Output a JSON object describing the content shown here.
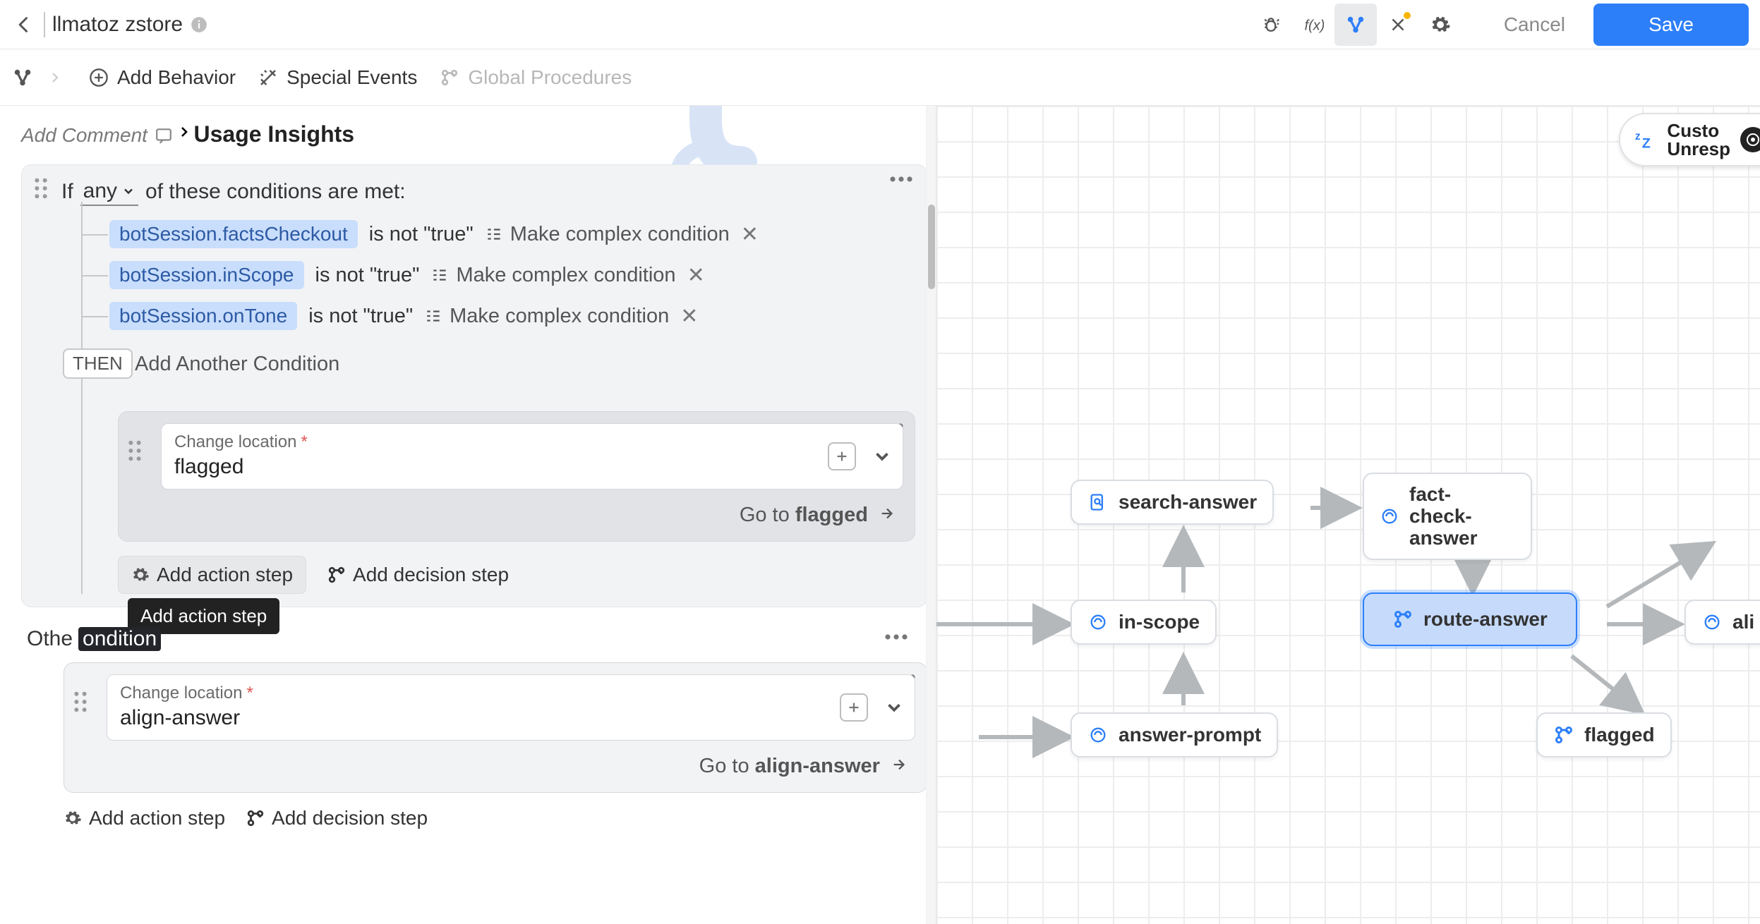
{
  "header": {
    "title": "llmatoz zstore",
    "cancel": "Cancel",
    "save": "Save"
  },
  "secondary": {
    "add_behavior": "Add Behavior",
    "special_events": "Special Events",
    "global_procedures": "Global Procedures"
  },
  "left": {
    "add_comment": "Add Comment",
    "usage_insights": "Usage Insights",
    "rule": {
      "if": "If",
      "any": "any",
      "of_text": "of these conditions are met:",
      "conditions": [
        {
          "var": "botSession.factsCheckout",
          "op": "is not \"true\"",
          "complex": "Make complex condition"
        },
        {
          "var": "botSession.inScope",
          "op": "is not \"true\"",
          "complex": "Make complex condition"
        },
        {
          "var": "botSession.onTone",
          "op": "is not \"true\"",
          "complex": "Make complex condition"
        }
      ],
      "add_another": "Add Another Condition",
      "then": "THEN",
      "action1": {
        "label": "Change location",
        "value": "flagged",
        "goto_prefix": "Go to ",
        "goto_target": "flagged"
      },
      "add_action": "Add action step",
      "add_decision": "Add decision step",
      "tooltip": "Add action step"
    },
    "otherwise": {
      "label_visible": "Othe",
      "covered": "ondition",
      "action": {
        "label": "Change location",
        "value": "align-answer",
        "goto_prefix": "Go to ",
        "goto_target": "align-answer"
      },
      "add_action": "Add action step",
      "add_decision": "Add decision step"
    }
  },
  "right": {
    "custom_unresp_1": "Custo",
    "custom_unresp_2": "Unresp",
    "nodes": {
      "search_answer": "search-answer",
      "fact_check": "fact- check-answer",
      "in_scope": "in-scope",
      "route_answer": "route-answer",
      "align": "ali",
      "answer_prompt": "answer-prompt",
      "flagged": "flagged"
    }
  }
}
